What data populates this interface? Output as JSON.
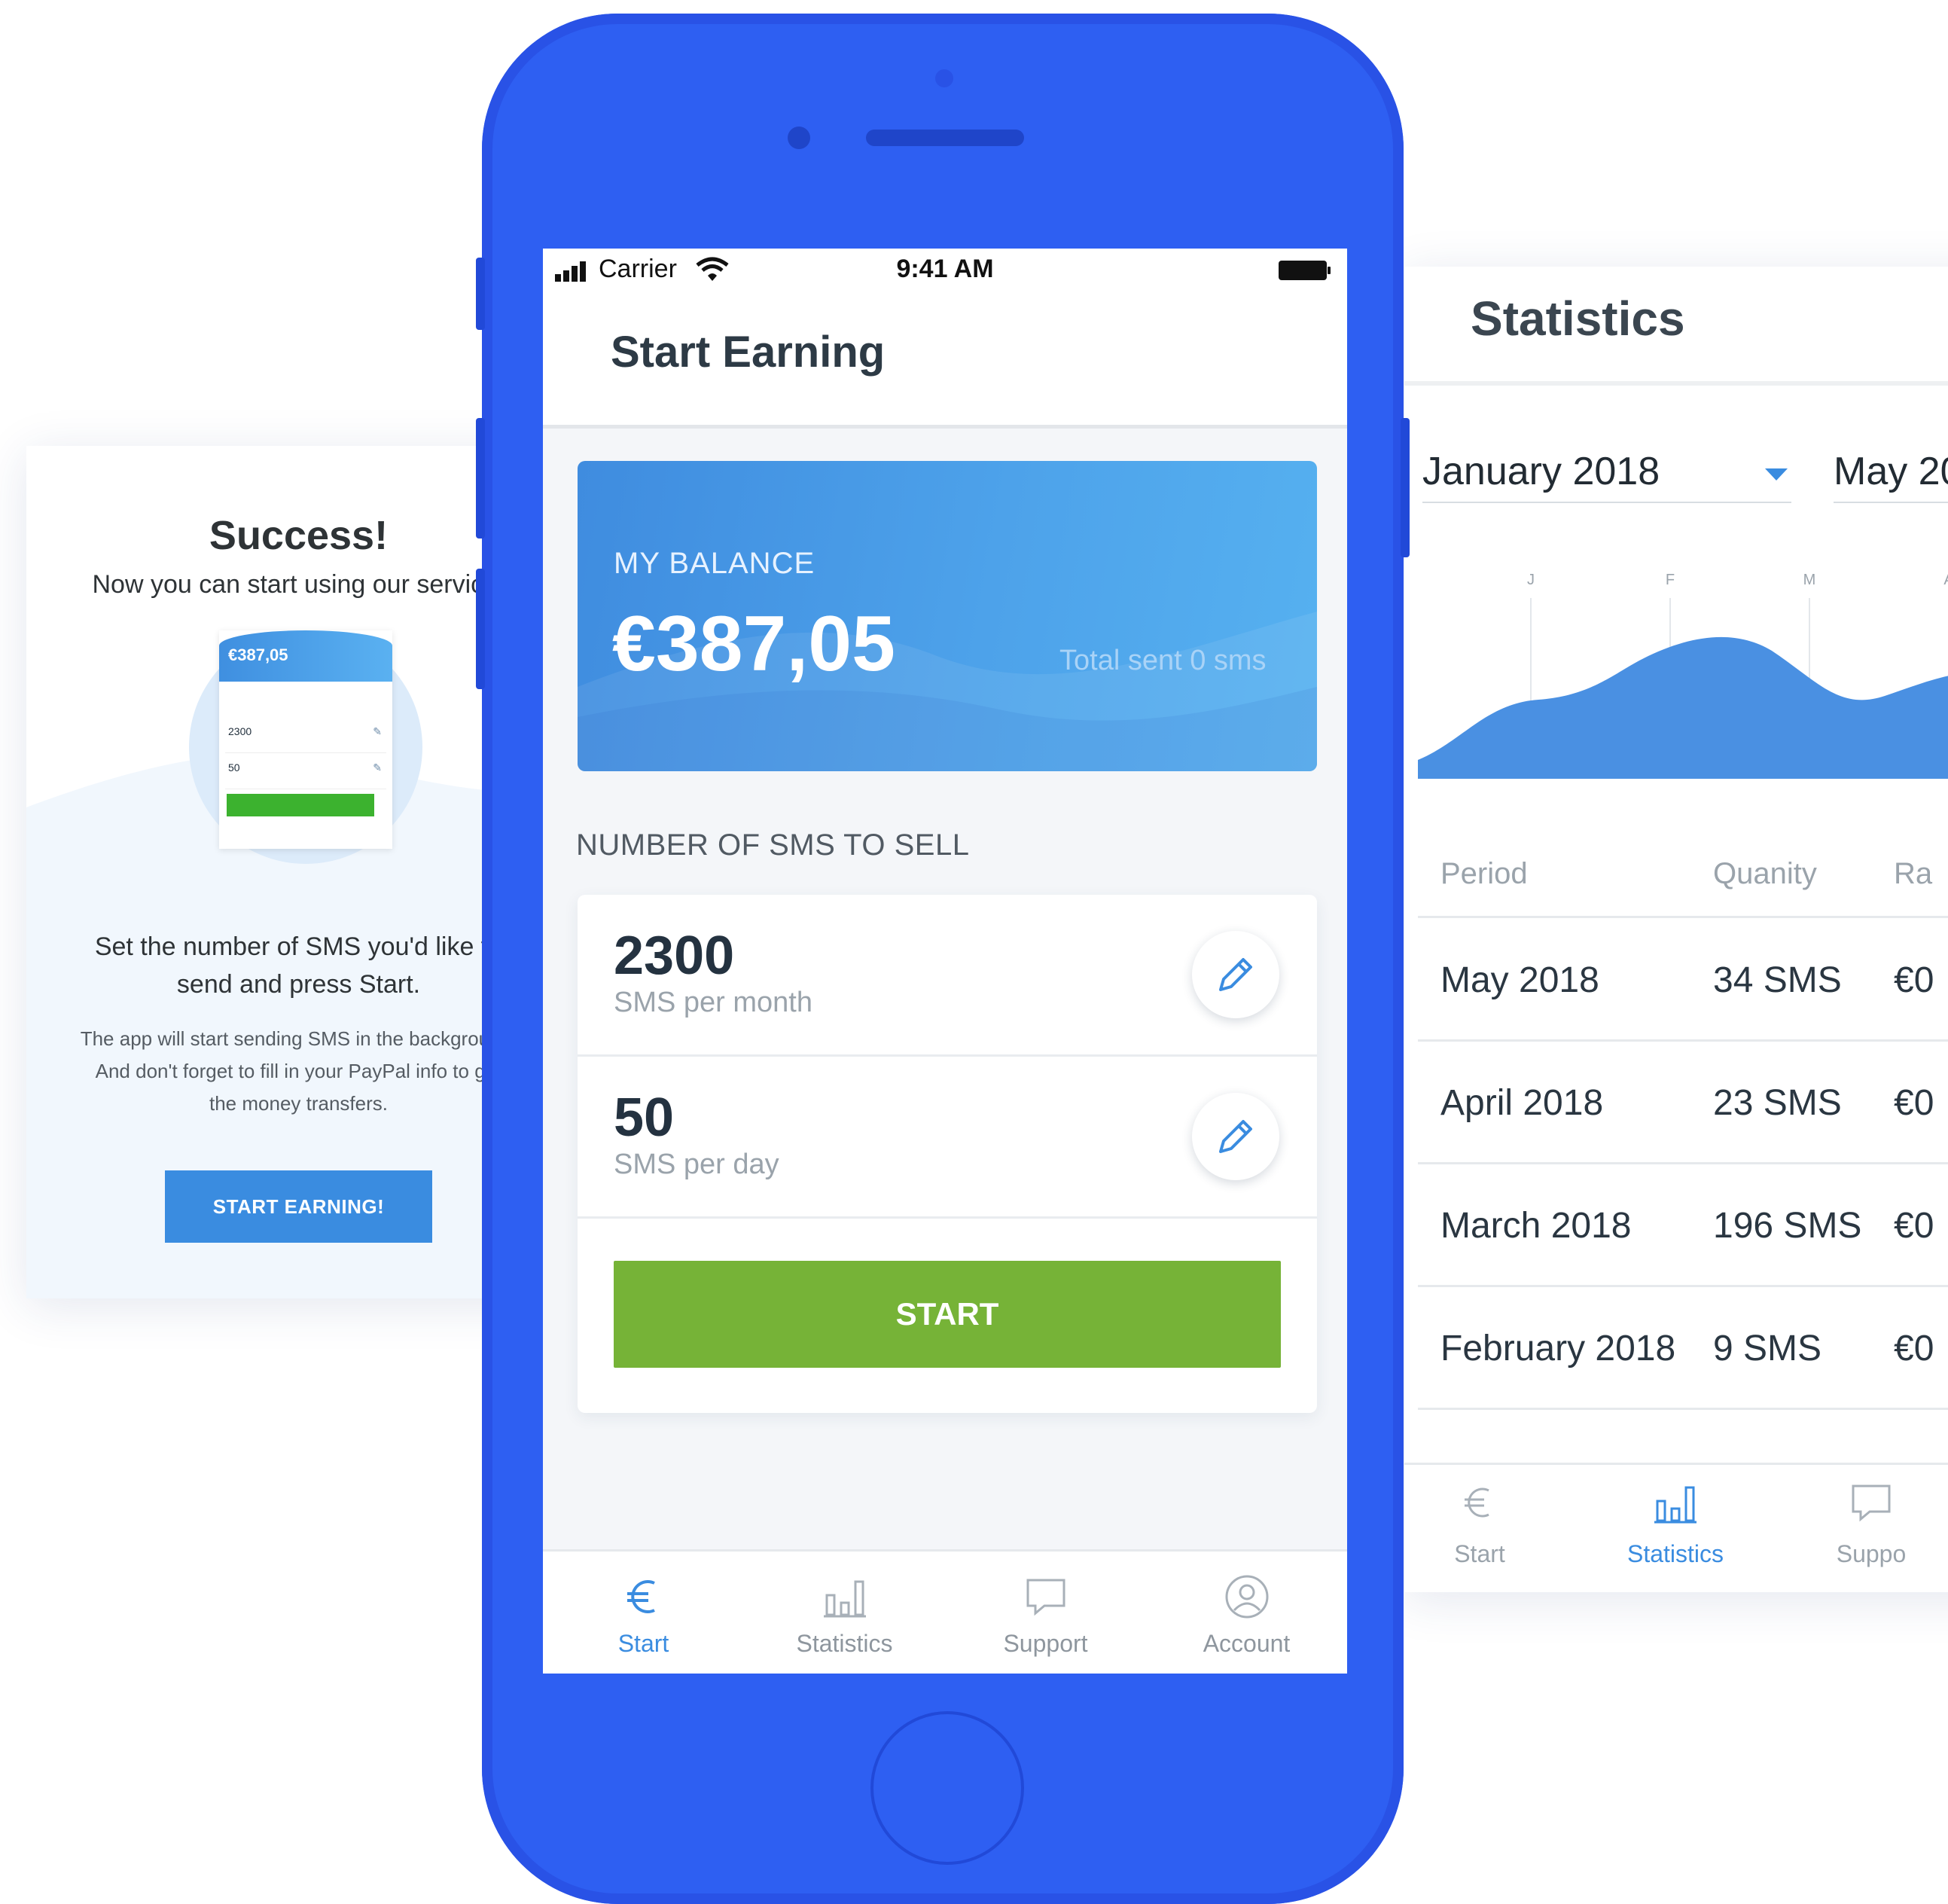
{
  "success_card": {
    "help_icon": "question-icon",
    "title": "Success!",
    "subtitle": "Now you can start using our service.",
    "preview": {
      "balance": "€387,05",
      "value_1": "2300",
      "value_2": "50"
    },
    "main_text": "Set the number of SMS you'd like to send and press Start.",
    "detail_text": "The app will start sending SMS in the background. And don't forget to fill in your PayPal info to get the money transfers.",
    "button_label": "START EARNING!"
  },
  "phone": {
    "status_bar": {
      "carrier": "Carrier",
      "time": "9:41 AM"
    },
    "page_title": "Start Earning",
    "balance": {
      "label": "MY BALANCE",
      "value": "€387,05",
      "total_sent": "Total sent 0 sms"
    },
    "sms_section_label": "NUMBER OF SMS TO SELL",
    "sms_settings": [
      {
        "value": "2300",
        "unit": "SMS per month"
      },
      {
        "value": "50",
        "unit": "SMS per day"
      }
    ],
    "start_button": "START",
    "nav": [
      {
        "label": "Start",
        "icon": "euro-icon",
        "active": true
      },
      {
        "label": "Statistics",
        "icon": "bar-chart-icon",
        "active": false
      },
      {
        "label": "Support",
        "icon": "chat-bubble-icon",
        "active": false
      },
      {
        "label": "Account",
        "icon": "user-circle-icon",
        "active": false
      }
    ]
  },
  "statistics": {
    "title": "Statistics",
    "date_from": "January 2018",
    "date_to": "May 20",
    "chart_months": [
      "J",
      "F",
      "M",
      "A"
    ],
    "table_headers": [
      "Period",
      "Quanity",
      "Ra"
    ],
    "rows": [
      {
        "period": "May 2018",
        "quantity": "34 SMS",
        "rate": "€0"
      },
      {
        "period": "April 2018",
        "quantity": "23 SMS",
        "rate": "€0"
      },
      {
        "period": "March 2018",
        "quantity": "196 SMS",
        "rate": "€0"
      },
      {
        "period": "February 2018",
        "quantity": "9 SMS",
        "rate": "€0"
      }
    ],
    "nav": [
      {
        "label": "Start",
        "icon": "euro-icon",
        "active": false
      },
      {
        "label": "Statistics",
        "icon": "bar-chart-icon",
        "active": true
      },
      {
        "label": "Suppo",
        "icon": "chat-bubble-icon",
        "active": false
      }
    ]
  },
  "colors": {
    "phone_body": "#2e5ff2",
    "accent_blue": "#3a8ce0",
    "start_green": "#76b337"
  }
}
